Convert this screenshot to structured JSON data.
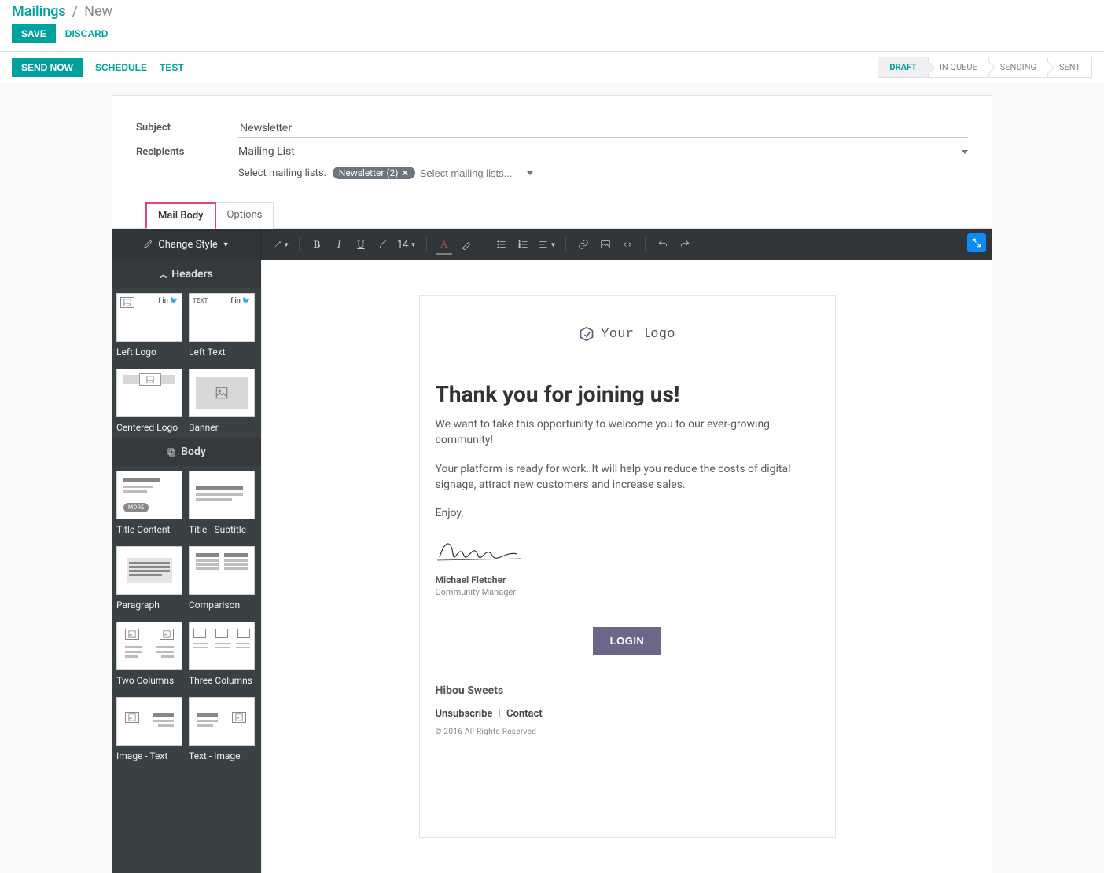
{
  "breadcrumb": {
    "main": "Mailings",
    "current": "New"
  },
  "header_buttons": {
    "save": "SAVE",
    "discard": "DISCARD"
  },
  "action_buttons": {
    "send_now": "SEND NOW",
    "schedule": "SCHEDULE",
    "test": "TEST"
  },
  "stages": [
    "DRAFT",
    "IN QUEUE",
    "SENDING",
    "SENT"
  ],
  "stage_active_index": 0,
  "form": {
    "subject_label": "Subject",
    "subject_value": "Newsletter",
    "recipients_label": "Recipients",
    "recipients_value": "Mailing List",
    "mailing_lists_label": "Select mailing lists:",
    "selected_list_tag": "Newsletter (2)",
    "mailing_list_placeholder": "Select mailing lists..."
  },
  "tabs": {
    "mail_body": "Mail Body",
    "options": "Options"
  },
  "editor": {
    "change_style": "Change Style",
    "font_size": "14"
  },
  "sidebar": {
    "headers_title": "Headers",
    "body_title": "Body",
    "headers": [
      "Left Logo",
      "Left Text",
      "Centered Logo",
      "Banner"
    ],
    "body": [
      "Title Content",
      "Title - Subtitle",
      "Paragraph",
      "Comparison",
      "Two Columns",
      "Three Columns",
      "Image - Text",
      "Text - Image"
    ],
    "text_badge": "TEXT",
    "more_badge": "MORE"
  },
  "email": {
    "logo_text": "Your logo",
    "heading": "Thank you for joining us!",
    "para1": "We want to take this opportunity to welcome you to our ever-growing community!",
    "para2": "Your platform is ready for work. It will help you reduce the costs of digital signage, attract new customers and increase sales.",
    "para3": "Enjoy,",
    "sig_name": "Michael Fletcher",
    "sig_title": "Community Manager",
    "login_button": "LOGIN",
    "company": "Hibou Sweets",
    "unsubscribe": "Unsubscribe",
    "contact": "Contact",
    "copyright": "© 2016 All Rights Reserved"
  }
}
